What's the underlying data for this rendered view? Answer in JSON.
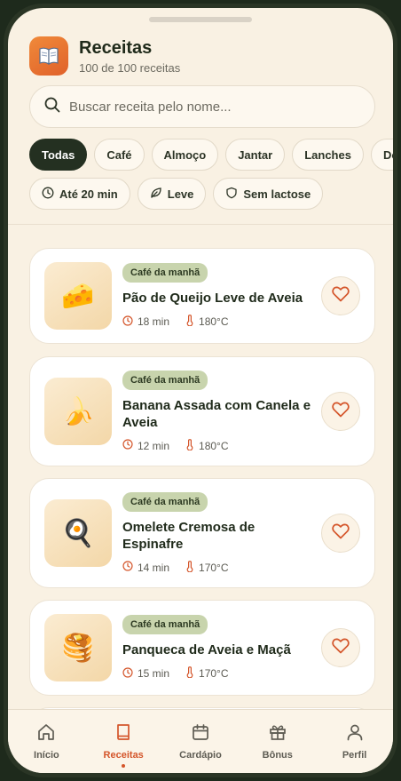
{
  "header": {
    "title": "Receitas",
    "subtitle": "100 de 100 receitas",
    "icon": "book-icon"
  },
  "search": {
    "placeholder": "Buscar receita pelo nome...",
    "value": ""
  },
  "categories": [
    {
      "label": "Todas",
      "active": true
    },
    {
      "label": "Café",
      "active": false
    },
    {
      "label": "Almoço",
      "active": false
    },
    {
      "label": "Jantar",
      "active": false
    },
    {
      "label": "Lanches",
      "active": false
    },
    {
      "label": "Doces",
      "active": false
    }
  ],
  "filters": [
    {
      "label": "Até 20 min",
      "icon": "clock-icon"
    },
    {
      "label": "Leve",
      "icon": "leaf-icon"
    },
    {
      "label": "Sem lactose",
      "icon": "shield-icon"
    }
  ],
  "recipes": [
    {
      "category": "Café da manhã",
      "title": "Pão de Queijo Leve de Aveia",
      "time": "18 min",
      "temp": "180°C",
      "emoji": "🧀"
    },
    {
      "category": "Café da manhã",
      "title": "Banana Assada com Canela e Aveia",
      "time": "12 min",
      "temp": "180°C",
      "emoji": "🍌"
    },
    {
      "category": "Café da manhã",
      "title": "Omelete Cremosa de Espinafre",
      "time": "14 min",
      "temp": "170°C",
      "emoji": "🍳"
    },
    {
      "category": "Café da manhã",
      "title": "Panqueca de Aveia e Maçã",
      "time": "15 min",
      "temp": "170°C",
      "emoji": "🥞"
    }
  ],
  "nav": [
    {
      "label": "Início",
      "icon": "home-icon",
      "active": false
    },
    {
      "label": "Receitas",
      "icon": "book-icon",
      "active": true
    },
    {
      "label": "Cardápio",
      "icon": "calendar-icon",
      "active": false
    },
    {
      "label": "Bônus",
      "icon": "gift-icon",
      "active": false
    },
    {
      "label": "Perfil",
      "icon": "user-icon",
      "active": false
    }
  ],
  "colors": {
    "accent": "#d4552a",
    "dark": "#243021",
    "badge": "#c8d4ad",
    "background": "#f9f1e3"
  }
}
